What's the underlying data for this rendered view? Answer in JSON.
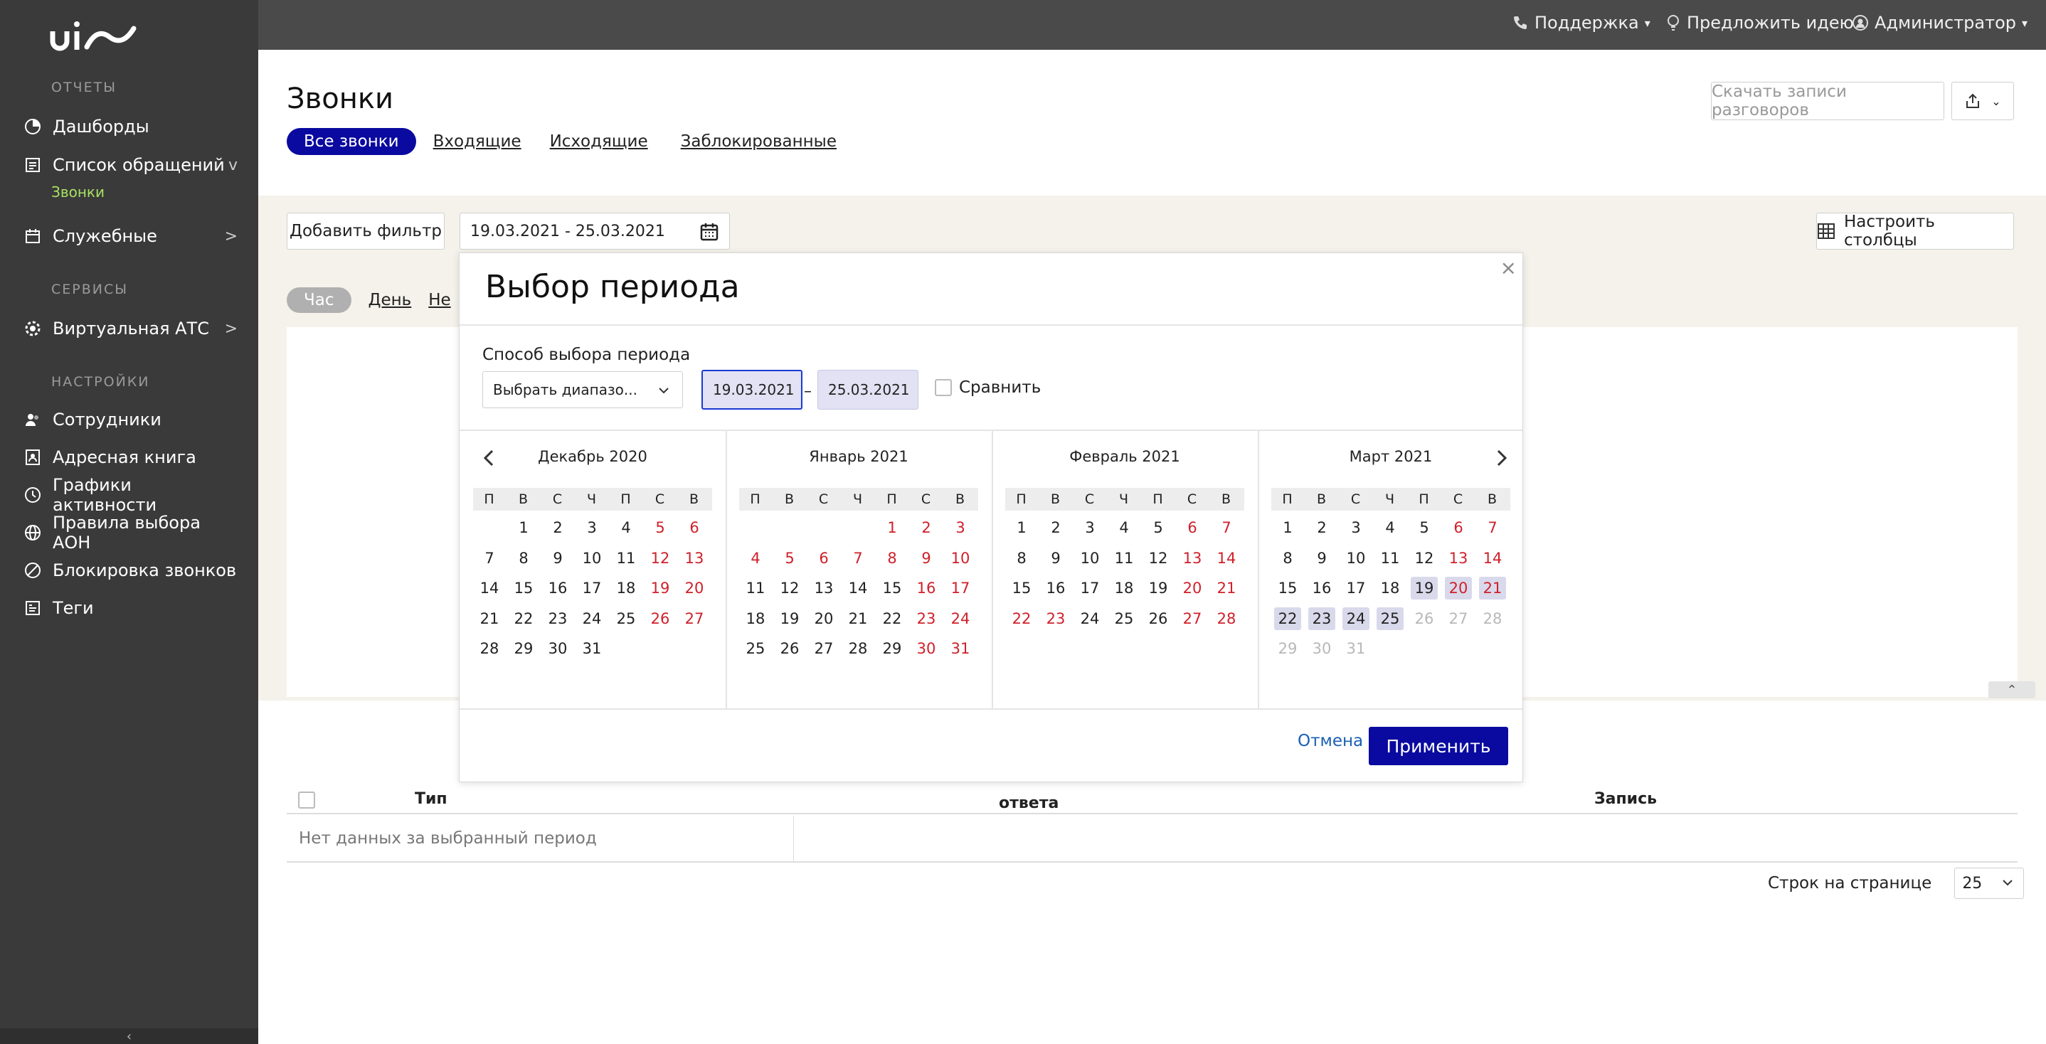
{
  "sidebar": {
    "sections": [
      "ОТЧЕТЫ",
      "СЕРВИСЫ",
      "НАСТРОЙКИ"
    ],
    "items": [
      {
        "label": "Дашборды",
        "icon": "pie-chart-icon"
      },
      {
        "label": "Список обращений",
        "icon": "list-icon",
        "arrow": "v"
      },
      {
        "label": "Служебные",
        "icon": "calendar-icon",
        "arrow": ">"
      },
      {
        "label": "Виртуальная АТС",
        "icon": "gear-icon",
        "arrow": ">"
      },
      {
        "label": "Сотрудники",
        "icon": "users-icon"
      },
      {
        "label": "Адресная книга",
        "icon": "address-book-icon"
      },
      {
        "label": "Графики активности",
        "icon": "clock-icon"
      },
      {
        "label": "Правила выбора АОН",
        "icon": "globe-icon"
      },
      {
        "label": "Блокировка звонков",
        "icon": "block-icon"
      },
      {
        "label": "Теги",
        "icon": "tag-icon"
      }
    ],
    "sub_active": "Звонки",
    "collapse": "‹"
  },
  "topbar": {
    "support": "Поддержка",
    "suggest": "Предложить идею",
    "admin": "Администратор"
  },
  "page": {
    "title": "Звонки",
    "tabs": [
      "Все звонки",
      "Входящие",
      "Исходящие",
      "Заблокированные"
    ],
    "download_btn": "Скачать записи разговоров",
    "add_filter": "Добавить фильтр",
    "date_range": "19.03.2021 - 25.03.2021",
    "configure_columns": "Настроить столбцы",
    "granularity": [
      "Час",
      "День",
      "Не"
    ]
  },
  "table": {
    "col_type": "Тип",
    "col_answer": "ответа",
    "col_record": "Запись",
    "no_data": "Нет данных за выбранный период",
    "rows_per_page_label": "Строк на странице",
    "rows_per_page": "25"
  },
  "modal": {
    "title": "Выбор периода",
    "close": "×",
    "method_label": "Способ выбора периода",
    "method_value": "Выбрать диапазо...",
    "date_from": "19.03.2021",
    "date_to": "25.03.2021",
    "dash": "–",
    "compare": "Сравнить",
    "cancel": "Отмена",
    "apply": "Применить",
    "weekdays": [
      "П",
      "В",
      "С",
      "Ч",
      "П",
      "С",
      "В"
    ],
    "months": [
      {
        "title": "Декабрь 2020",
        "first_weekday": 1,
        "days": 31
      },
      {
        "title": "Январь 2021",
        "first_weekday": 4,
        "days": 31
      },
      {
        "title": "Февраль 2021",
        "first_weekday": 0,
        "days": 28
      },
      {
        "title": "Март 2021",
        "first_weekday": 0,
        "days": 31
      }
    ],
    "extra_holidays": {
      "Январь 2021": [
        1,
        4,
        5,
        6,
        7,
        8
      ],
      "Февраль 2021": [
        22,
        23
      ]
    },
    "selected": {
      "month": "Март 2021",
      "from": 19,
      "to": 25
    },
    "disabled_after": {
      "month": "Март 2021",
      "day": 25
    },
    "colors": {
      "accent": "#0a0aa0",
      "weekend": "#d0202a",
      "selected_bg": "#d9d9ec"
    }
  }
}
